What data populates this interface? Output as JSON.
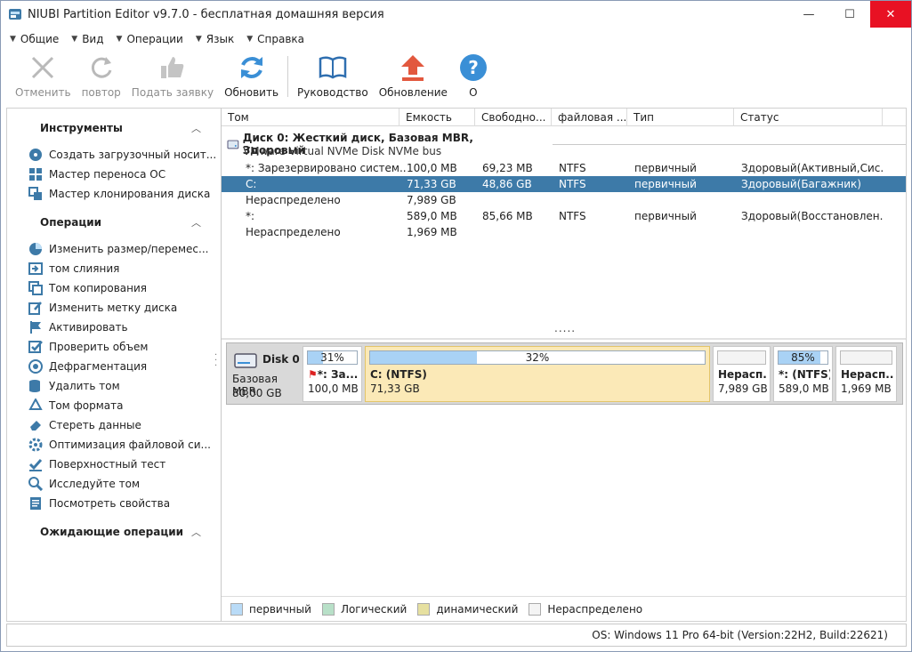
{
  "window": {
    "title": "NIUBI Partition Editor v9.7.0 - бесплатная домашняя версия",
    "min": "—",
    "max": "☐",
    "close": "✕"
  },
  "menu": [
    "Общие",
    "Вид",
    "Операции",
    "Язык",
    "Справка"
  ],
  "toolbar": {
    "undo": "Отменить",
    "redo": "повтор",
    "apply": "Подать заявку",
    "refresh": "Обновить",
    "guide": "Руководство",
    "update": "Обновление",
    "about": "О"
  },
  "sidebar": {
    "tools_title": "Инструменты",
    "tools": [
      "Создать загрузочный носит...",
      "Мастер переноса ОС",
      "Мастер клонирования диска"
    ],
    "ops_title": "Операции",
    "ops": [
      "Изменить размер/перемес...",
      "том слияния",
      "Том копирования",
      "Изменить метку диска",
      "Активировать",
      "Проверить объем",
      "Дефрагментация",
      "Удалить том",
      "Том формата",
      "Стереть данные",
      "Оптимизация файловой си...",
      "Поверхностный тест",
      "Исследуйте том",
      "Посмотреть свойства"
    ],
    "pending_title": "Ожидающие операции"
  },
  "columns": [
    "Том",
    "Емкость",
    "Свободно...",
    "файловая ...",
    "Тип",
    "Статус"
  ],
  "disk": {
    "header": "Диск 0: Жесткий диск, Базовая MBR, Здоровый",
    "sub": "VMware Virtual NVMe Disk NVMe bus",
    "rows": [
      {
        "vol": "*: Зарезервировано систем...",
        "cap": "100,0 MB",
        "free": "69,23 MB",
        "fs": "NTFS",
        "type": "первичный",
        "status": "Здоровый(Активный,Сис..."
      },
      {
        "vol": "C:",
        "cap": "71,33 GB",
        "free": "48,86 GB",
        "fs": "NTFS",
        "type": "первичный",
        "status": "Здоровый(Багажник)"
      },
      {
        "vol": "Нераспределено",
        "cap": "7,989 GB",
        "free": "",
        "fs": "",
        "type": "",
        "status": ""
      },
      {
        "vol": "*:",
        "cap": "589,0 MB",
        "free": "85,66 MB",
        "fs": "NTFS",
        "type": "первичный",
        "status": "Здоровый(Восстановлен..."
      },
      {
        "vol": "Нераспределено",
        "cap": "1,969 MB",
        "free": "",
        "fs": "",
        "type": "",
        "status": ""
      }
    ],
    "dots": ".....",
    "map": {
      "name": "Disk 0",
      "type": "Базовая MBR",
      "size": "80,00 GB",
      "parts": [
        {
          "pct": "31%",
          "fill": 0.31,
          "name": "*: За...",
          "size": "100,0 MB"
        },
        {
          "pct": "32%",
          "fill": 0.32,
          "name": "C: (NTFS)",
          "size": "71,33 GB"
        },
        {
          "pct": "",
          "fill": 0,
          "name": "Нерасп...",
          "size": "7,989 GB"
        },
        {
          "pct": "85%",
          "fill": 0.85,
          "name": "*: (NTFS)",
          "size": "589,0 MB"
        },
        {
          "pct": "",
          "fill": 0,
          "name": "Нерасп...",
          "size": "1,969 MB"
        }
      ]
    }
  },
  "legend": [
    {
      "label": "первичный",
      "color": "#b9dbf7"
    },
    {
      "label": "Логический",
      "color": "#b8e0c8"
    },
    {
      "label": "динамический",
      "color": "#e6e0a0"
    },
    {
      "label": "Нераспределено",
      "color": "#f4f4f4"
    }
  ],
  "status": "OS: Windows 11 Pro 64-bit (Version:22H2, Build:22621)"
}
